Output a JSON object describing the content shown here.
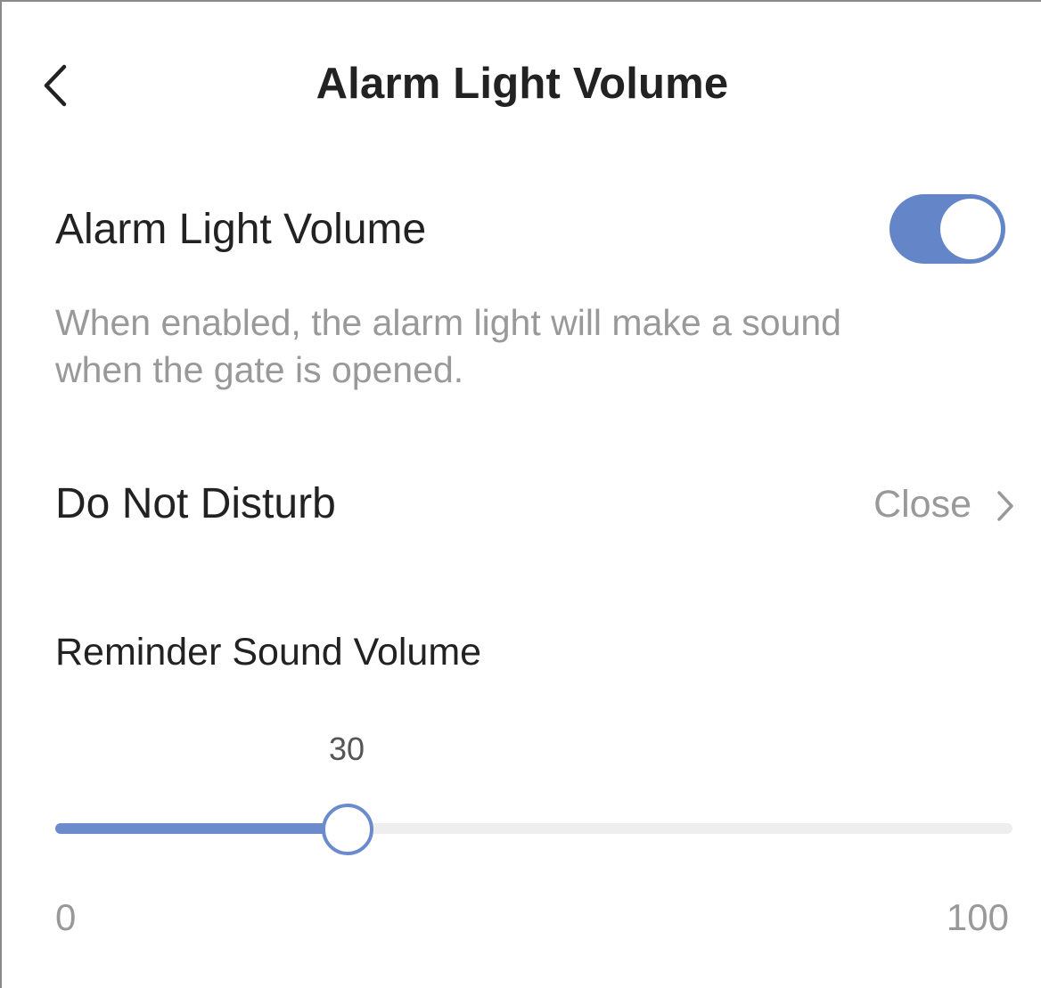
{
  "header": {
    "title": "Alarm Light Volume",
    "back_icon": "chevron-left-icon"
  },
  "alarm_light": {
    "label": "Alarm Light Volume",
    "enabled": true,
    "description_line1": "When enabled, the alarm light will make a sound",
    "description_line2": "when the gate is opened."
  },
  "do_not_disturb": {
    "label": "Do Not Disturb",
    "value": "Close",
    "chevron_icon": "chevron-right-icon"
  },
  "reminder": {
    "label": "Reminder Sound Volume",
    "value": 30,
    "value_text": "30",
    "min": 0,
    "max": 100,
    "min_label": "0",
    "max_label": "100"
  },
  "colors": {
    "accent": "#6b8bcc",
    "toggle_on": "#6485c7",
    "track": "#eeeeee",
    "secondary_text": "#999999",
    "primary_text": "#222222"
  }
}
